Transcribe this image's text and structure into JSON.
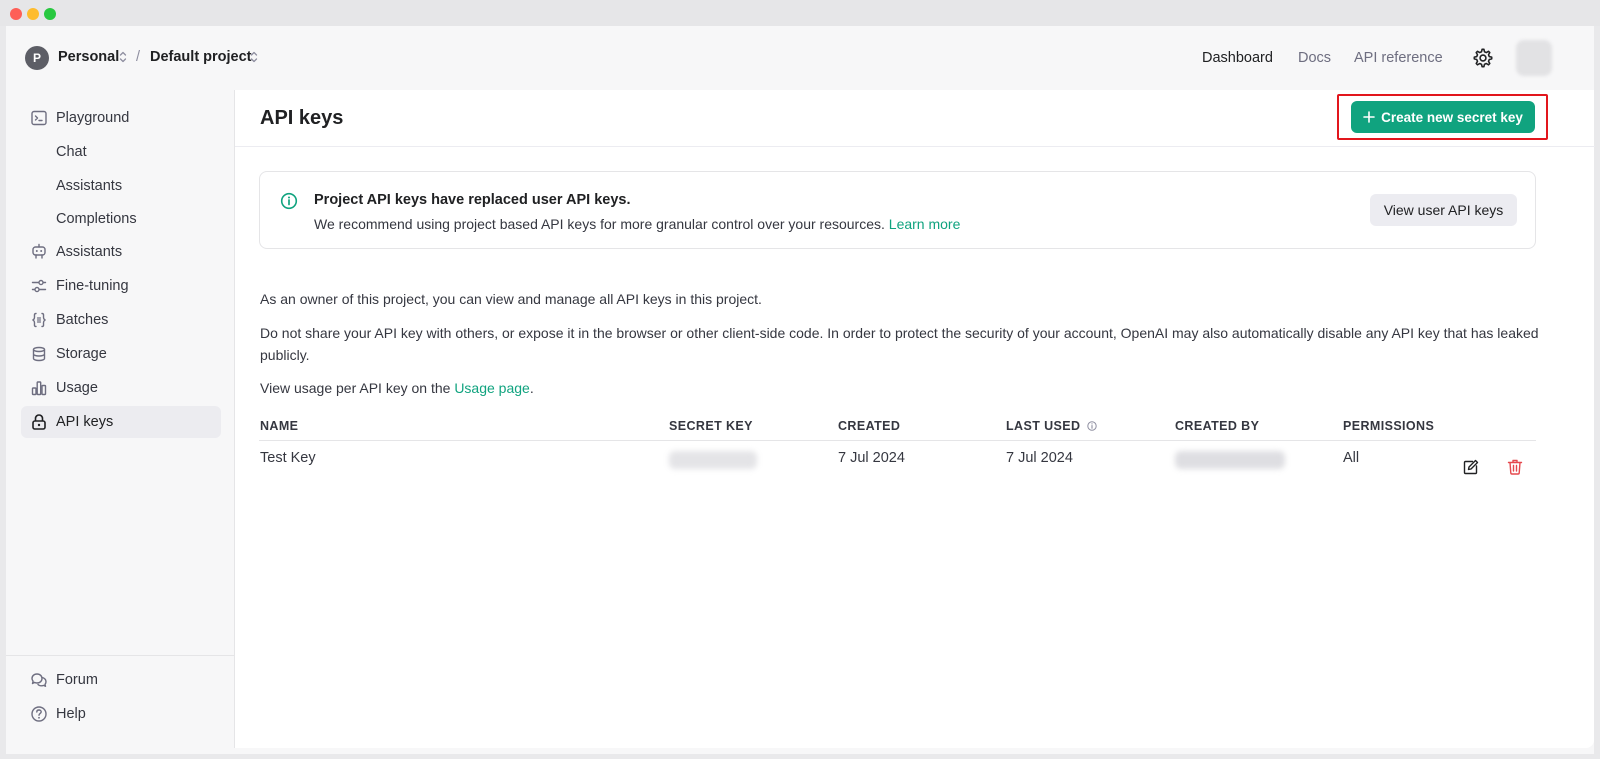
{
  "colors": {
    "accent": "#10a37f",
    "highlight": "#e2161d",
    "danger": "#e5484d"
  },
  "header": {
    "org_initial": "P",
    "org_name": "Personal",
    "separator": "/",
    "project_name": "Default project",
    "nav": {
      "dashboard": "Dashboard",
      "docs": "Docs",
      "api_reference": "API reference"
    },
    "settings_icon": "gear-icon"
  },
  "sidebar": {
    "playground": "Playground",
    "chat": "Chat",
    "assistants_sub": "Assistants",
    "completions": "Completions",
    "assistants": "Assistants",
    "fine_tuning": "Fine-tuning",
    "batches": "Batches",
    "storage": "Storage",
    "usage": "Usage",
    "api_keys": "API keys",
    "forum": "Forum",
    "help": "Help",
    "active": "API keys"
  },
  "main": {
    "title": "API keys",
    "create_button": "Create new secret key",
    "notice": {
      "title": "Project API keys have replaced user API keys.",
      "body": "We recommend using project based API keys for more granular control over your resources.",
      "link": "Learn more",
      "button": "View user API keys"
    },
    "para1": "As an owner of this project, you can view and manage all API keys in this project.",
    "para2": "Do not share your API key with others, or expose it in the browser or other client-side code. In order to protect the security of your account, OpenAI may also automatically disable any API key that has leaked publicly.",
    "para3_prefix": "View usage per API key on the",
    "para3_link": "Usage page",
    "para3_suffix": ".",
    "table": {
      "headers": {
        "name": "NAME",
        "secret_key": "SECRET KEY",
        "created": "CREATED",
        "last_used": "LAST USED",
        "created_by": "CREATED BY",
        "permissions": "PERMISSIONS"
      },
      "rows": [
        {
          "name": "Test Key",
          "created": "7 Jul 2024",
          "last_used": "7 Jul 2024",
          "permissions": "All"
        }
      ]
    }
  }
}
